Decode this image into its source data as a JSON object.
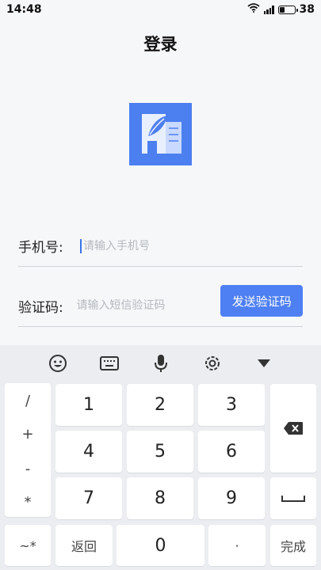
{
  "status_bar": {
    "time": "14:48",
    "battery": "38",
    "battery_level": 0.38,
    "icons": [
      "wifi-icon",
      "signal-icon",
      "battery-icon"
    ]
  },
  "header": {
    "title": "登录"
  },
  "logo": {
    "icon": "building-leaf-icon",
    "color": "#4c7ff0"
  },
  "form": {
    "phone_label": "手机号:",
    "phone_placeholder": "请输入手机号",
    "code_label": "验证码:",
    "code_placeholder": "请输入短信验证码",
    "send_code_label": "发送验证码"
  },
  "keyboard": {
    "toolbar": [
      "emoji-icon",
      "keyboard-icon",
      "microphone-icon",
      "settings-icon",
      "collapse-icon"
    ],
    "symbols": [
      "/",
      "+",
      "-",
      "*"
    ],
    "digits": [
      "1",
      "2",
      "3",
      "4",
      "5",
      "6",
      "7",
      "8",
      "9"
    ],
    "bottom": {
      "symbols_key": "~*",
      "back": "返回",
      "zero": "0",
      "dot": "·",
      "done": "完成"
    }
  },
  "colors": {
    "accent": "#4e7ff3",
    "background": "#f6f7f9",
    "keyboard": "#ebedf1"
  }
}
